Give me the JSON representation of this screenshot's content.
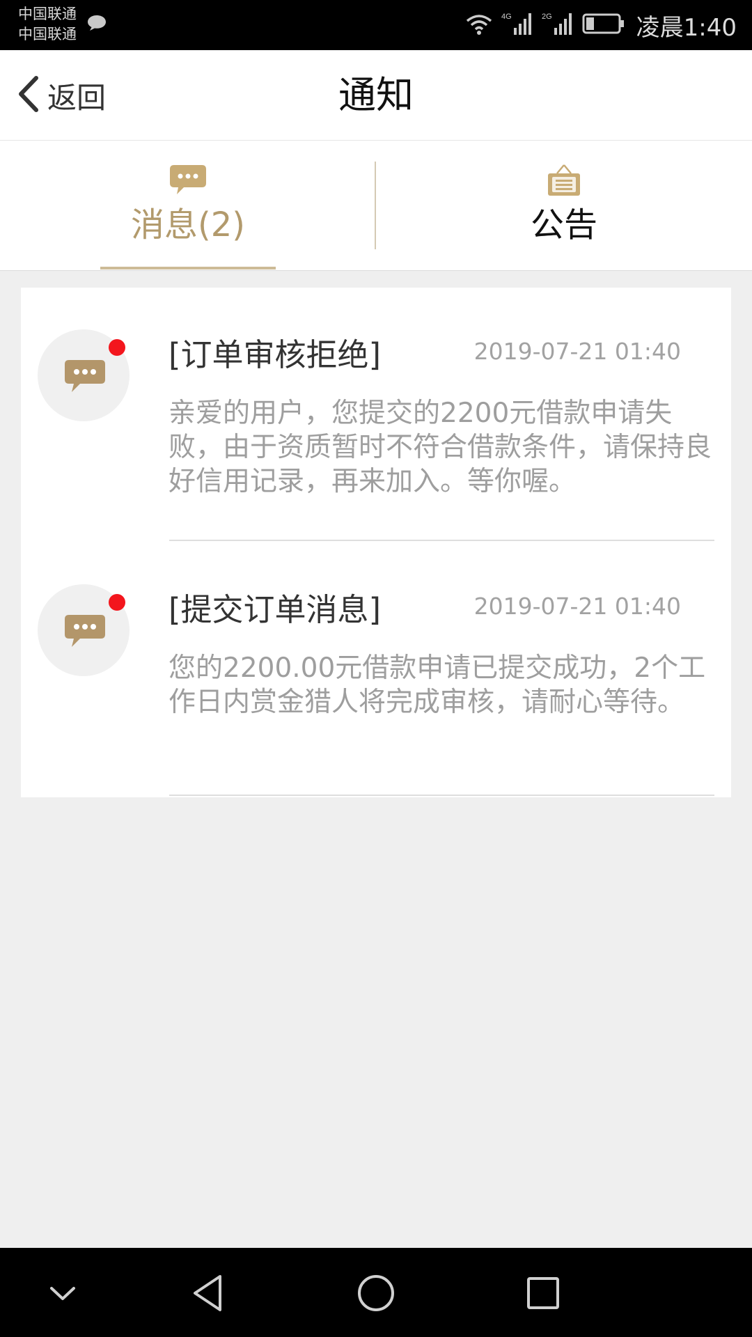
{
  "status_bar": {
    "carrier_1": "中国联通",
    "carrier_2": "中国联通",
    "net_1": "4G",
    "net_2": "2G",
    "time": "凌晨1:40",
    "battery_level": 0.25,
    "icons": [
      "chat-bubble-icon",
      "wifi-icon",
      "signal-icon",
      "battery-icon"
    ]
  },
  "header": {
    "back_label": "返回",
    "title": "通知"
  },
  "tabs": [
    {
      "label": "消息(2)",
      "icon": "message-bubble-icon",
      "active": true
    },
    {
      "label": "公告",
      "icon": "announcement-board-icon",
      "active": false
    }
  ],
  "messages": [
    {
      "title": "[订单审核拒绝]",
      "time": "2019-07-21 01:40",
      "body": "亲爱的用户，您提交的2200元借款申请失败，由于资质暂时不符合借款条件，请保持良好信用记录，再来加入。等你喔。",
      "unread": true
    },
    {
      "title": "[提交订单消息]",
      "time": "2019-07-21 01:40",
      "body": "您的2200.00元借款申请已提交成功，2个工作日内赏金猎人将完成审核，请耐心等待。",
      "unread": true
    }
  ],
  "nav_bar": {
    "icons": [
      "chevron-down-icon",
      "back-triangle-icon",
      "home-circle-icon",
      "recents-square-icon"
    ]
  },
  "colors": {
    "accent": "#b29a6c",
    "unread_dot": "#f3161d",
    "background": "#efefef"
  }
}
